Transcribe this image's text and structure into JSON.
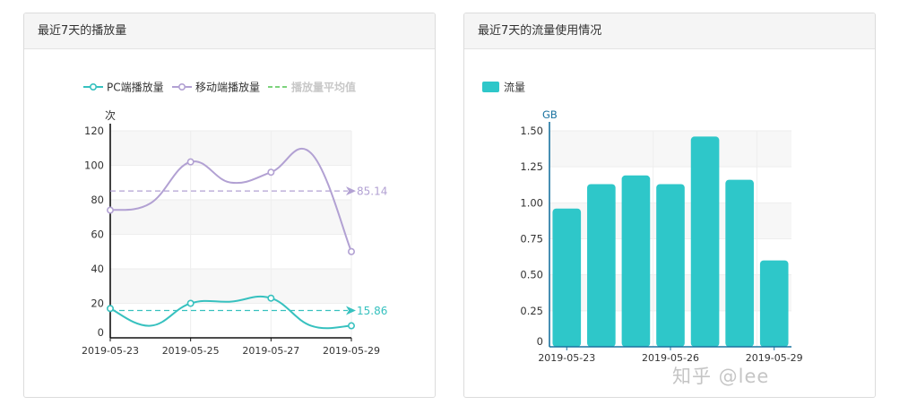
{
  "left_panel": {
    "title": "最近7天的播放量"
  },
  "right_panel": {
    "title": "最近7天的流量使用情况"
  },
  "watermark": {
    "text": "知乎 @lee"
  },
  "colors": {
    "pc": "#37c1bf",
    "mobile": "#b2a1d3",
    "avg_legend": "#7dd37d",
    "avg_legend_text": "#c8c8c8",
    "bar": "#2ec7c9",
    "axis": "#111111",
    "gb_axis": "#1a73a0"
  },
  "chart_data": [
    {
      "type": "line",
      "ylabel": "次",
      "x": [
        "2019-05-23",
        "2019-05-24",
        "2019-05-25",
        "2019-05-26",
        "2019-05-27",
        "2019-05-28",
        "2019-05-29"
      ],
      "x_tick_labels": [
        "2019-05-23",
        "2019-05-25",
        "2019-05-27",
        "2019-05-29"
      ],
      "ylim": [
        0,
        120
      ],
      "y_ticks": [
        0,
        20,
        40,
        60,
        80,
        100,
        120
      ],
      "grid": true,
      "legend_position": "top",
      "legend": [
        "PC端播放量",
        "移动端播放量",
        "播放量平均值"
      ],
      "series": [
        {
          "name": "PC端播放量",
          "values": [
            17,
            7,
            20,
            21,
            23,
            7,
            7
          ]
        },
        {
          "name": "移动端播放量",
          "values": [
            74,
            78,
            102,
            90,
            96,
            107,
            50
          ]
        }
      ],
      "averages": [
        {
          "series": "PC端播放量",
          "value": 15.86,
          "label": "15.86"
        },
        {
          "series": "移动端播放量",
          "value": 85.14,
          "label": "85.14"
        }
      ]
    },
    {
      "type": "bar",
      "ylabel": "GB",
      "categories": [
        "2019-05-23",
        "2019-05-24",
        "2019-05-25",
        "2019-05-26",
        "2019-05-27",
        "2019-05-28",
        "2019-05-29"
      ],
      "x_tick_labels": [
        "2019-05-23",
        "2019-05-26",
        "2019-05-29"
      ],
      "values": [
        0.96,
        1.13,
        1.19,
        1.13,
        1.46,
        1.16,
        0.6
      ],
      "ylim": [
        0,
        1.5
      ],
      "y_ticks": [
        "0",
        "0.25",
        "0.50",
        "0.75",
        "1.00",
        "1.25",
        "1.50"
      ],
      "grid": true,
      "legend_position": "top-left",
      "legend": [
        "流量"
      ]
    }
  ]
}
